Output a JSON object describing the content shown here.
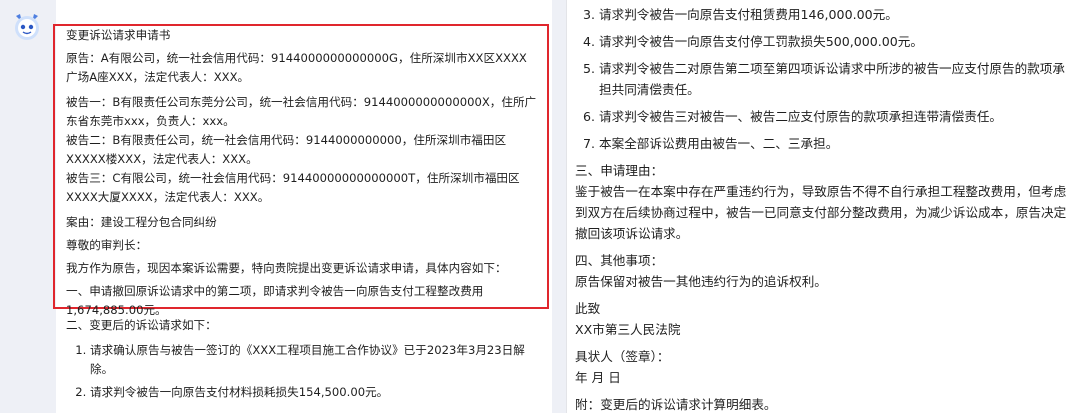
{
  "left": {
    "title": "变更诉讼请求申请书",
    "plaintiff": "原告：A有限公司，统一社会信用代码：9144000000000000G，住所深圳市XX区XXXX广场A座XXX，法定代表人：XXX。",
    "defendant1": "被告一：B有限责任公司东莞分公司，统一社会信用代码：9144000000000000X，住所广东省东莞市xxx，负责人：xxx。",
    "defendant2": "被告二：B有限责任公司，统一社会信用代码：9144000000000，住所深圳市福田区XXXXX楼XXX，法定代表人：XXX。",
    "defendant3": "被告三：C有限公司，统一社会信用代码：91440000000000000T，住所深圳市福田区XXXX大厦XXXX，法定代表人：XXX。",
    "case": "案由：建设工程分包合同纠纷",
    "salutation": "尊敬的审判长：",
    "intro": "我方作为原告，现因本案诉讼需要，特向贵院提出变更诉讼请求申请，具体内容如下：",
    "item1": "一、申请撤回原诉讼请求中的第二项，即请求判令被告一向原告支付工程整改费用1,674,885.00元。",
    "item2_heading": "二、变更后的诉讼请求如下：",
    "claims_left": [
      "请求确认原告与被告一签订的《XXX工程项目施工合作协议》已于2023年3月23日解除。",
      "请求判令被告一向原告支付材料损耗损失154,500.00元。"
    ]
  },
  "right": {
    "claims": [
      "请求判令被告一向原告支付租赁费用146,000.00元。",
      "请求判令被告一向原告支付停工罚款损失500,000.00元。",
      "请求判令被告二对原告第二项至第四项诉讼请求中所涉的被告一应支付原告的款项承担共同清偿责任。",
      "请求判令被告三对被告一、被告二应支付原告的款项承担连带清偿责任。",
      "本案全部诉讼费用由被告一、二、三承担。"
    ],
    "reason_heading": "三、申请理由：",
    "reason_text": "鉴于被告一在本案中存在严重违约行为，导致原告不得不自行承担工程整改费用，但考虑到双方在后续协商过程中，被告一已同意支付部分整改费用，为减少诉讼成本，原告决定撤回该项诉讼请求。",
    "other_heading": "四、其他事项：",
    "other_text": "原告保留对被告一其他违约行为的追诉权利。",
    "closing1": "此致",
    "court": "XX市第三人民法院",
    "signature": "具状人（签章）：",
    "date": "年 月 日",
    "attachment": "附：变更后的诉讼请求计算明细表。"
  },
  "colors": {
    "highlight": "#e0262d",
    "avatar": "#5a8be8"
  },
  "icons": {
    "avatar": "bot-avatar-icon"
  }
}
